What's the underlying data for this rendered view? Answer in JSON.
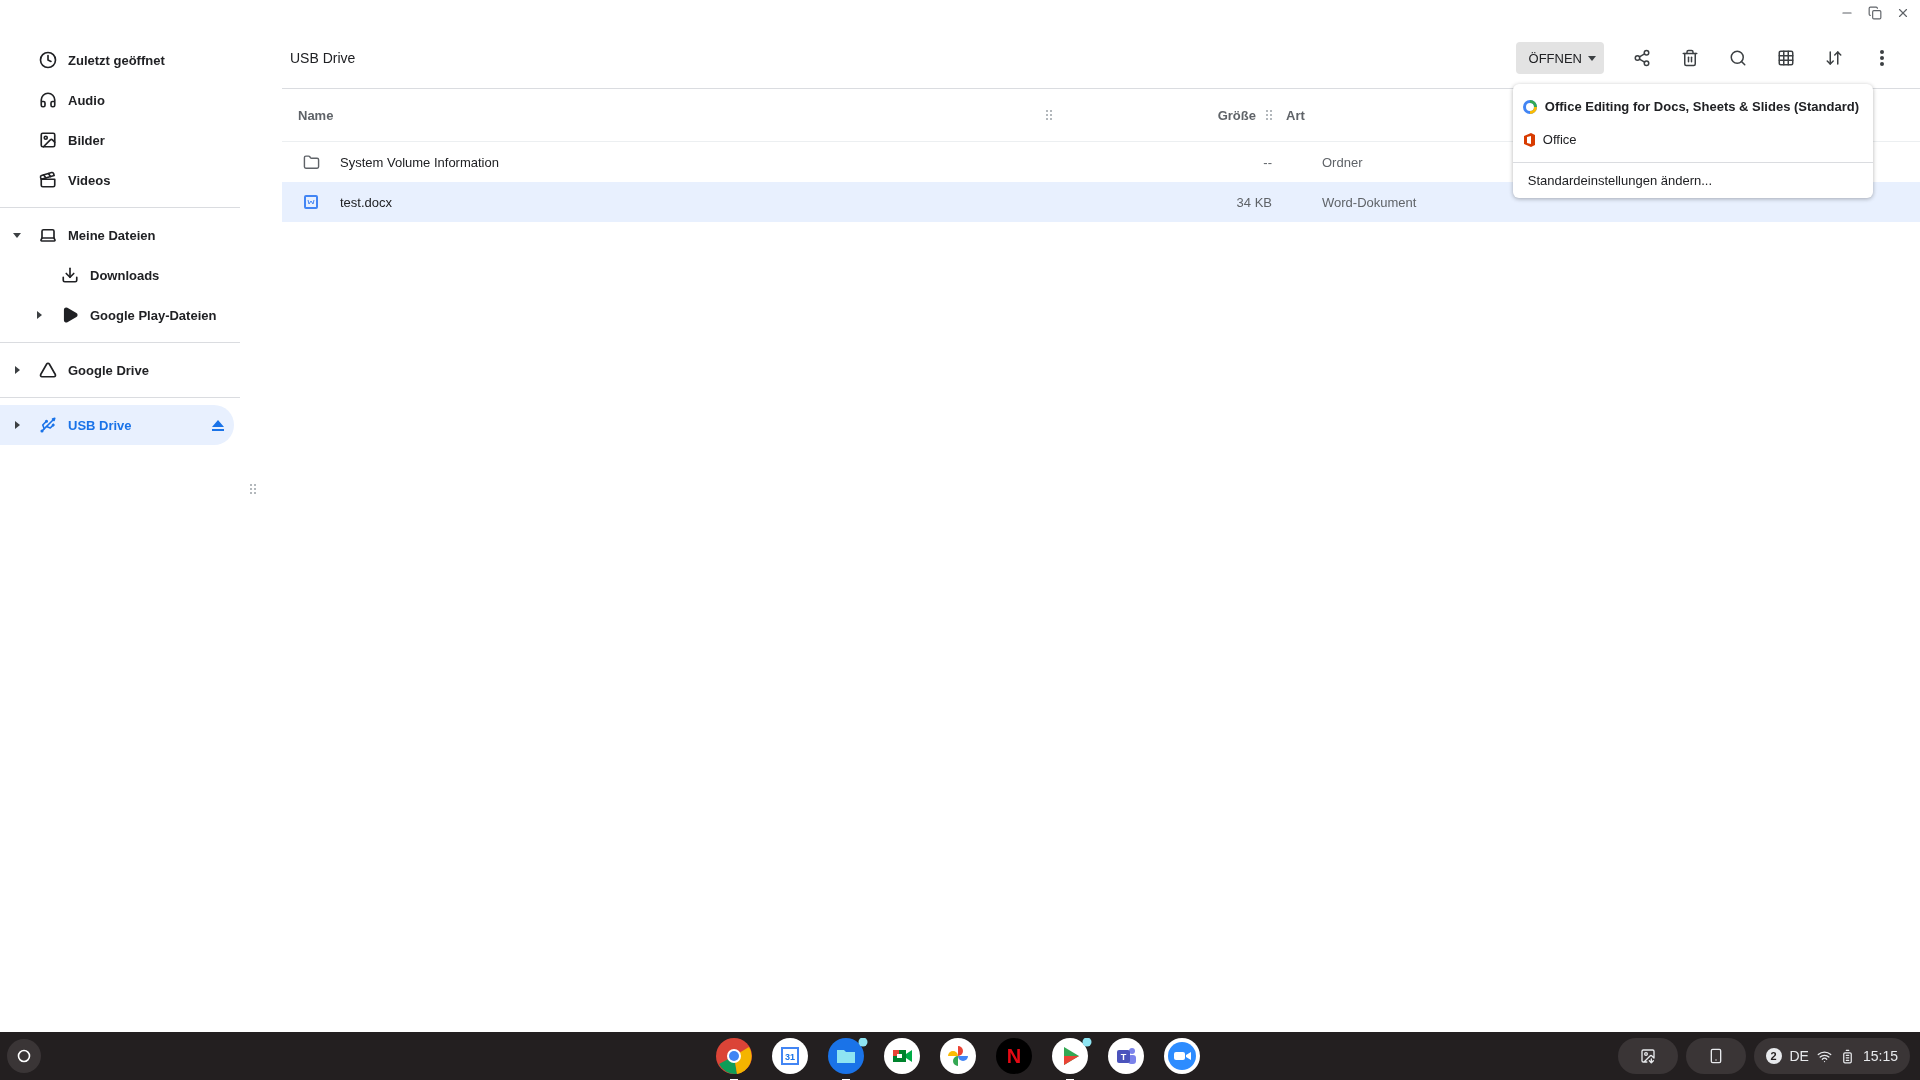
{
  "sidebar": {
    "shortcuts": [
      {
        "kind": "recent",
        "label": "Zuletzt geöffnet"
      },
      {
        "kind": "audio",
        "label": "Audio"
      },
      {
        "kind": "images",
        "label": "Bilder"
      },
      {
        "kind": "videos",
        "label": "Videos"
      }
    ],
    "roots": [
      {
        "kind": "computer",
        "label": "Meine Dateien",
        "expanded": true,
        "selected": false,
        "children": [
          {
            "kind": "download",
            "label": "Downloads",
            "selected": false
          },
          {
            "kind": "play",
            "label": "Google Play-Dateien",
            "expanded": false,
            "selected": false
          }
        ]
      },
      {
        "kind": "drive",
        "label": "Google Drive",
        "expanded": false,
        "selected": false
      },
      {
        "kind": "usb",
        "label": "USB Drive",
        "expanded": false,
        "selected": true,
        "eject": true
      }
    ]
  },
  "toolbar": {
    "breadcrumb": "USB Drive",
    "open_button": "ÖFFNEN"
  },
  "table": {
    "columns": [
      "Name",
      "Größe",
      "Art"
    ],
    "rows": [
      {
        "kind": "folder",
        "name": "System Volume Information",
        "size": "--",
        "type": "Ordner",
        "selected": false
      },
      {
        "kind": "word",
        "name": "test.docx",
        "size": "34 KB",
        "type": "Word-Dokument",
        "selected": true
      }
    ]
  },
  "open_menu": {
    "items": [
      {
        "kind": "docs",
        "label": "Office Editing for Docs, Sheets & Slides (Standard)",
        "default": true
      },
      {
        "kind": "office",
        "label": "Office",
        "default": false
      }
    ],
    "footer": "Standardeinstellungen ändern..."
  },
  "shelf": {
    "apps": [
      {
        "kind": "chrome",
        "running": true,
        "badge": false
      },
      {
        "kind": "calendar",
        "glyph": "31",
        "running": false,
        "badge": false
      },
      {
        "kind": "files",
        "running": true,
        "badge": true
      },
      {
        "kind": "meet",
        "running": false,
        "badge": false
      },
      {
        "kind": "photos",
        "running": false,
        "badge": false
      },
      {
        "kind": "netflix",
        "glyph": "N",
        "running": false,
        "badge": false
      },
      {
        "kind": "play",
        "running": true,
        "badge": true
      },
      {
        "kind": "teams",
        "glyph": "T",
        "running": false,
        "badge": false
      },
      {
        "kind": "zoom",
        "running": false,
        "badge": false
      }
    ],
    "tray": {
      "notifications": "2",
      "keyboard": "DE",
      "time": "15:15"
    }
  }
}
